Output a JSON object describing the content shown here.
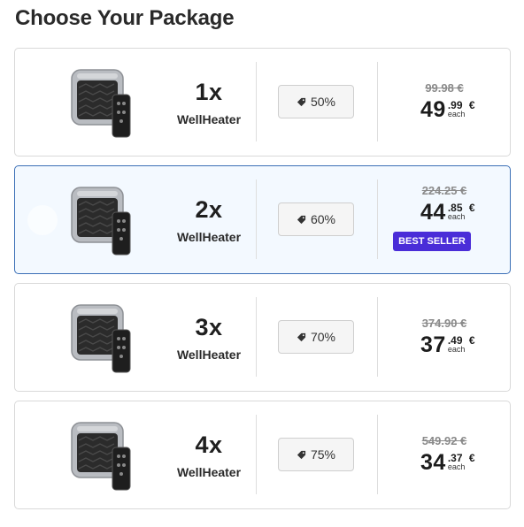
{
  "page": {
    "title": "Choose Your Package"
  },
  "colors": {
    "selected_border": "#3b6fb6",
    "selected_bg": "#f3f9ff",
    "badge_bg": "#4a2dd8"
  },
  "packages": [
    {
      "qty": "1x",
      "name": "WellHeater",
      "discount": "50%",
      "old_price": "99.98 €",
      "price_int": "49",
      "price_dec": ".99",
      "each": "each",
      "currency": "€",
      "selected": false
    },
    {
      "qty": "2x",
      "name": "WellHeater",
      "discount": "60%",
      "old_price": "224.25 €",
      "price_int": "44",
      "price_dec": ".85",
      "each": "each",
      "currency": "€",
      "selected": true,
      "badge": "BEST SELLER"
    },
    {
      "qty": "3x",
      "name": "WellHeater",
      "discount": "70%",
      "old_price": "374.90 €",
      "price_int": "37",
      "price_dec": ".49",
      "each": "each",
      "currency": "€",
      "selected": false
    },
    {
      "qty": "4x",
      "name": "WellHeater",
      "discount": "75%",
      "old_price": "549.92 €",
      "price_int": "34",
      "price_dec": ".37",
      "each": "each",
      "currency": "€",
      "selected": false
    }
  ]
}
